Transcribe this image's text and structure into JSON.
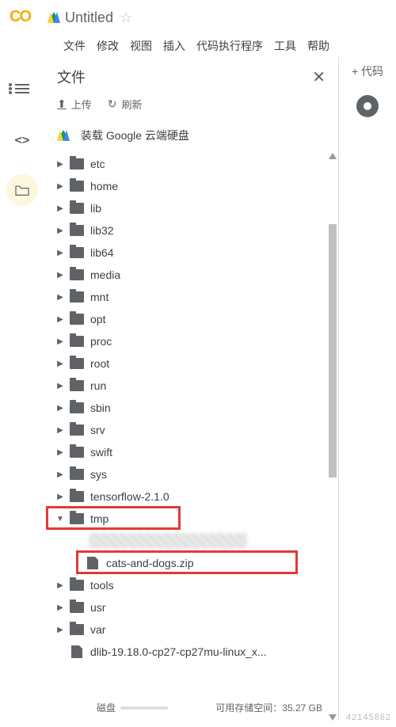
{
  "header": {
    "doc_title": "Untitled"
  },
  "menubar": {
    "file": "文件",
    "edit": "修改",
    "view": "视图",
    "insert": "插入",
    "runtime": "代码执行程序",
    "tools": "工具",
    "help": "帮助"
  },
  "panel": {
    "title": "文件",
    "upload": "上传",
    "refresh": "刷新",
    "mount_drive": "装载 Google 云端硬盘"
  },
  "right": {
    "add_code": "+ 代码"
  },
  "tree": [
    {
      "name": "etc",
      "type": "folder",
      "level": 0,
      "expanded": false
    },
    {
      "name": "home",
      "type": "folder",
      "level": 0,
      "expanded": false
    },
    {
      "name": "lib",
      "type": "folder",
      "level": 0,
      "expanded": false
    },
    {
      "name": "lib32",
      "type": "folder",
      "level": 0,
      "expanded": false
    },
    {
      "name": "lib64",
      "type": "folder",
      "level": 0,
      "expanded": false
    },
    {
      "name": "media",
      "type": "folder",
      "level": 0,
      "expanded": false
    },
    {
      "name": "mnt",
      "type": "folder",
      "level": 0,
      "expanded": false
    },
    {
      "name": "opt",
      "type": "folder",
      "level": 0,
      "expanded": false
    },
    {
      "name": "proc",
      "type": "folder",
      "level": 0,
      "expanded": false
    },
    {
      "name": "root",
      "type": "folder",
      "level": 0,
      "expanded": false
    },
    {
      "name": "run",
      "type": "folder",
      "level": 0,
      "expanded": false
    },
    {
      "name": "sbin",
      "type": "folder",
      "level": 0,
      "expanded": false
    },
    {
      "name": "srv",
      "type": "folder",
      "level": 0,
      "expanded": false
    },
    {
      "name": "swift",
      "type": "folder",
      "level": 0,
      "expanded": false
    },
    {
      "name": "sys",
      "type": "folder",
      "level": 0,
      "expanded": false
    },
    {
      "name": "tensorflow-2.1.0",
      "type": "folder",
      "level": 0,
      "expanded": false
    },
    {
      "name": "tmp",
      "type": "folder",
      "level": 0,
      "expanded": true,
      "highlight": true
    },
    {
      "name": "",
      "type": "blurred",
      "level": 1
    },
    {
      "name": "cats-and-dogs.zip",
      "type": "file",
      "level": 1,
      "highlight": true
    },
    {
      "name": "tools",
      "type": "folder",
      "level": 0,
      "expanded": false
    },
    {
      "name": "usr",
      "type": "folder",
      "level": 0,
      "expanded": false
    },
    {
      "name": "var",
      "type": "folder",
      "level": 0,
      "expanded": false
    },
    {
      "name": "dlib-19.18.0-cp27-cp27mu-linux_x...",
      "type": "file",
      "level": 0
    }
  ],
  "footer": {
    "disk_label": "磁盘",
    "free_label": "可用存储空间：",
    "free_value": "35.27 GB"
  },
  "watermark": "42145862"
}
